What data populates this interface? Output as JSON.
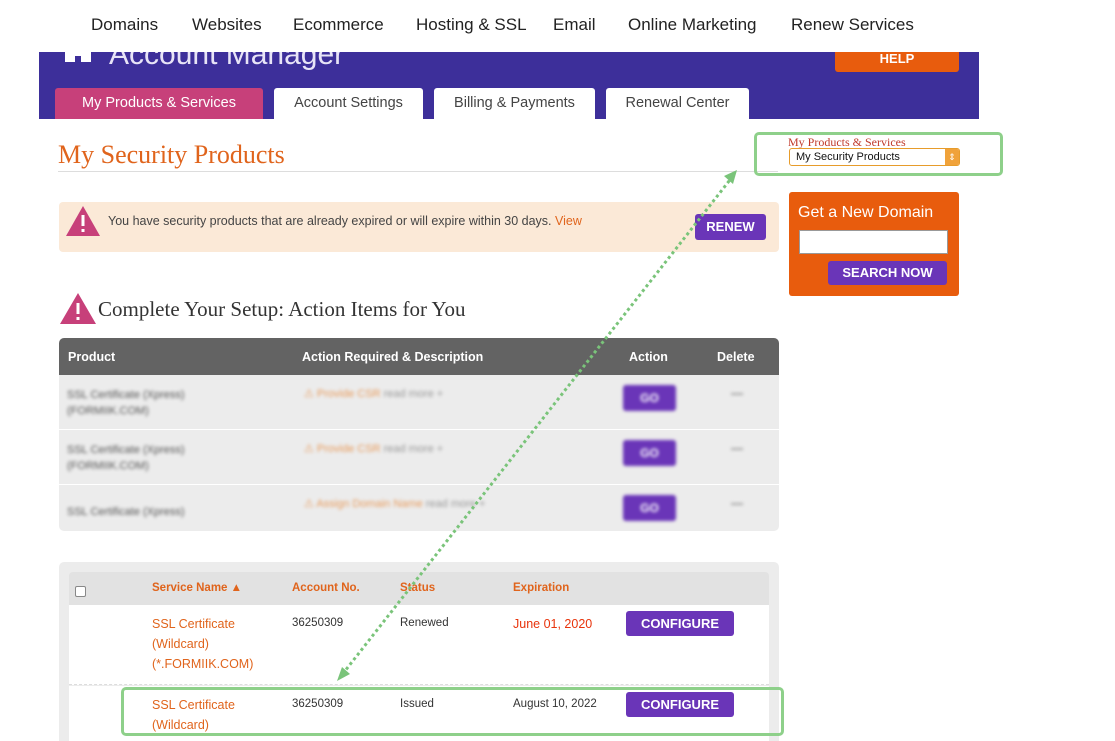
{
  "topnav": {
    "items": [
      "Domains",
      "Websites",
      "Ecommerce",
      "Hosting & SSL",
      "Email",
      "Online Marketing",
      "Renew Services"
    ]
  },
  "header": {
    "brand": "Account Manager",
    "help_label": "HELP",
    "tabs": [
      "My Products & Services",
      "Account Settings",
      "Billing & Payments",
      "Renewal Center"
    ],
    "active_tab": "My Products & Services"
  },
  "page": {
    "title": "My Security Products"
  },
  "selector": {
    "label": "My Products & Services",
    "selected": "My Security Products"
  },
  "alert": {
    "message": "You have security products that are already expired or will expire within 30 days.",
    "link": "View",
    "button": "RENEW"
  },
  "domain_search": {
    "heading": "Get a New Domain",
    "input_value": "",
    "button": "SEARCH NOW"
  },
  "setup": {
    "title": "Complete Your Setup: Action Items for You",
    "columns": [
      "Product",
      "Action Required & Description",
      "Action",
      "Delete"
    ],
    "rows": [
      {
        "product_line1": "SSL Certificate (Xpress)",
        "product_line2": "(FORMIIK.COM)",
        "action": "Provide CSR",
        "more": "read more +",
        "button": "GO"
      },
      {
        "product_line1": "SSL Certificate (Xpress)",
        "product_line2": "(FORMIIK.COM)",
        "action": "Provide CSR",
        "more": "read more +",
        "button": "GO"
      },
      {
        "product_line1": "SSL Certificate (Xpress)",
        "product_line2": "",
        "action": "Assign Domain Name",
        "more": "read more +",
        "button": "GO"
      }
    ]
  },
  "services": {
    "columns": {
      "service": "Service Name ▲",
      "account": "Account No.",
      "status": "Status",
      "expiration": "Expiration"
    },
    "rows": [
      {
        "name_line1": "SSL Certificate",
        "name_line2": "(Wildcard)",
        "name_line3": "(*.FORMIIK.COM)",
        "account": "36250309",
        "status": "Renewed",
        "expiration": "June 01, 2020",
        "button": "CONFIGURE"
      },
      {
        "name_line1": "SSL Certificate",
        "name_line2": "(Wildcard)",
        "name_line3": "",
        "account": "36250309",
        "status": "Issued",
        "expiration": "August 10, 2022",
        "button": "CONFIGURE"
      }
    ]
  },
  "colors": {
    "brand_purple": "#3d2f9a",
    "accent_orange": "#e85c0d",
    "button_purple": "#6a35b8",
    "tab_pink": "#c7407a",
    "highlight_green": "#8ed08a",
    "expired_red": "#e8340c"
  },
  "icons": [
    "home-icon",
    "warning-icon",
    "select-arrows-icon",
    "sort-up-icon"
  ]
}
